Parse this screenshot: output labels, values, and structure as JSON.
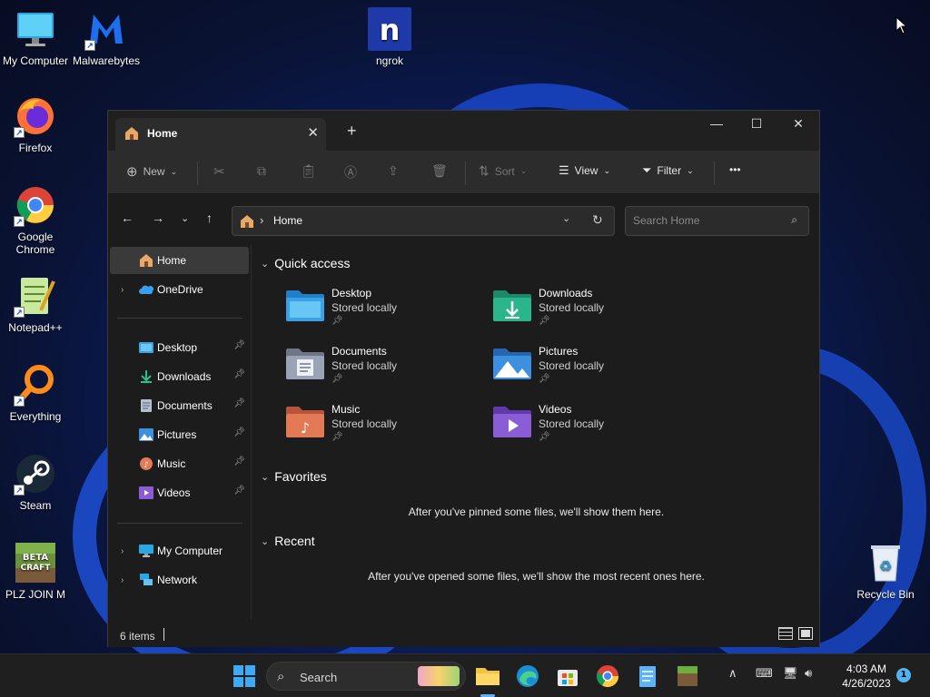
{
  "desktop": {
    "icons": [
      {
        "label": "My Computer",
        "icon": "monitor-icon"
      },
      {
        "label": "Malwarebytes",
        "icon": "malwarebytes-icon"
      },
      {
        "label": "ngrok",
        "icon": "ngrok-icon"
      },
      {
        "label": "Firefox",
        "icon": "firefox-icon"
      },
      {
        "label": "Google Chrome",
        "icon": "chrome-icon"
      },
      {
        "label": "Notepad++",
        "icon": "notepadpp-icon"
      },
      {
        "label": "Everything",
        "icon": "everything-icon"
      },
      {
        "label": "Steam",
        "icon": "steam-icon"
      },
      {
        "label": "PLZ JOIN M",
        "icon": "betacraft-icon",
        "logo_text": "BETA CRAFT"
      },
      {
        "label": "Recycle Bin",
        "icon": "recycle-bin-icon"
      }
    ]
  },
  "window": {
    "tab_label": "Home",
    "toolbar": {
      "new_label": "New",
      "sort_label": "Sort",
      "view_label": "View",
      "filter_label": "Filter",
      "more_label": "•••"
    },
    "address": {
      "separator": "›",
      "path": "Home"
    },
    "search_placeholder": "Search Home",
    "nav": {
      "top": [
        {
          "label": "Home",
          "icon": "home-icon"
        },
        {
          "label": "OneDrive",
          "icon": "onedrive-icon"
        }
      ],
      "pinned": [
        {
          "label": "Desktop",
          "icon": "desktop-folder-icon"
        },
        {
          "label": "Downloads",
          "icon": "downloads-icon"
        },
        {
          "label": "Documents",
          "icon": "documents-icon"
        },
        {
          "label": "Pictures",
          "icon": "pictures-icon"
        },
        {
          "label": "Music",
          "icon": "music-icon"
        },
        {
          "label": "Videos",
          "icon": "videos-icon"
        }
      ],
      "bottom": [
        {
          "label": "My Computer",
          "icon": "monitor-icon"
        },
        {
          "label": "Network",
          "icon": "network-icon"
        }
      ]
    },
    "sections": {
      "quick_access": "Quick access",
      "favorites": "Favorites",
      "favorites_empty": "After you've pinned some files, we'll show them here.",
      "recent": "Recent",
      "recent_empty": "After you've opened some files, we'll show the most recent ones here."
    },
    "quick_access_items": [
      {
        "name": "Desktop",
        "sub": "Stored locally",
        "color": "#3aa0e8"
      },
      {
        "name": "Downloads",
        "sub": "Stored locally",
        "color": "#2bb58a"
      },
      {
        "name": "Documents",
        "sub": "Stored locally",
        "color": "#9aa4b6"
      },
      {
        "name": "Pictures",
        "sub": "Stored locally",
        "color": "#3d8fe0"
      },
      {
        "name": "Music",
        "sub": "Stored locally",
        "color": "#e27a56"
      },
      {
        "name": "Videos",
        "sub": "Stored locally",
        "color": "#8a5cd6"
      }
    ],
    "status": {
      "item_count": "6 items"
    }
  },
  "taskbar": {
    "search_label": "Search",
    "time": "4:03 AM",
    "date": "4/26/2023",
    "notification_count": "1"
  }
}
